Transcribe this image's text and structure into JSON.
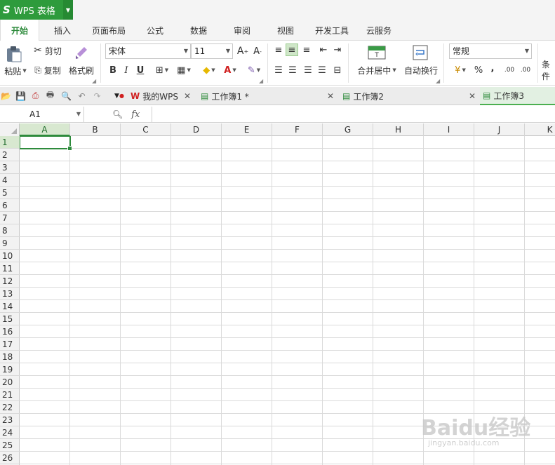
{
  "app": {
    "logo": "S",
    "name": "WPS 表格"
  },
  "menu": {
    "tabs": [
      {
        "label": "开始",
        "active": true
      },
      {
        "label": "插入"
      },
      {
        "label": "页面布局"
      },
      {
        "label": "公式"
      },
      {
        "label": "数据"
      },
      {
        "label": "审阅"
      },
      {
        "label": "视图"
      },
      {
        "label": "开发工具"
      },
      {
        "label": "云服务"
      }
    ]
  },
  "ribbon": {
    "paste": "粘贴",
    "cut": "剪切",
    "copy": "复制",
    "format_painter": "格式刷",
    "font_name": "宋体",
    "font_size": "11",
    "merge_center": "合并居中",
    "wrap_text": "自动换行",
    "number_format": "常规",
    "percent": "%",
    "comma": ",",
    "inc_decimal": ".00",
    "dec_decimal": ".00",
    "conditional": "条件",
    "bold": "B",
    "italic": "I",
    "underline": "U",
    "grow_font": "A",
    "shrink_font": "A",
    "font_color": "A"
  },
  "doc_tabs": [
    {
      "label": "我的WPS",
      "active": false
    },
    {
      "label": "工作簿1 *",
      "active": false
    },
    {
      "label": "工作簿2",
      "active": false
    },
    {
      "label": "工作簿3",
      "active": true
    }
  ],
  "formula_bar": {
    "cell_ref": "A1",
    "fx": "fx",
    "value": ""
  },
  "columns": [
    "A",
    "B",
    "C",
    "D",
    "E",
    "F",
    "G",
    "H",
    "I",
    "J",
    "K"
  ],
  "rows": [
    "1",
    "2",
    "3",
    "4",
    "5",
    "6",
    "7",
    "8",
    "9",
    "10",
    "11",
    "12",
    "13",
    "14",
    "15",
    "16",
    "17",
    "18",
    "19",
    "20",
    "21",
    "22",
    "23",
    "24",
    "25",
    "26"
  ],
  "selected": {
    "column": "A",
    "row": "1"
  },
  "colors": {
    "accent": "#2e9b3c",
    "selection": "#2e8b3c"
  },
  "watermark": {
    "brand": "Baidu经验",
    "url": "jingyan.baidu.com"
  }
}
